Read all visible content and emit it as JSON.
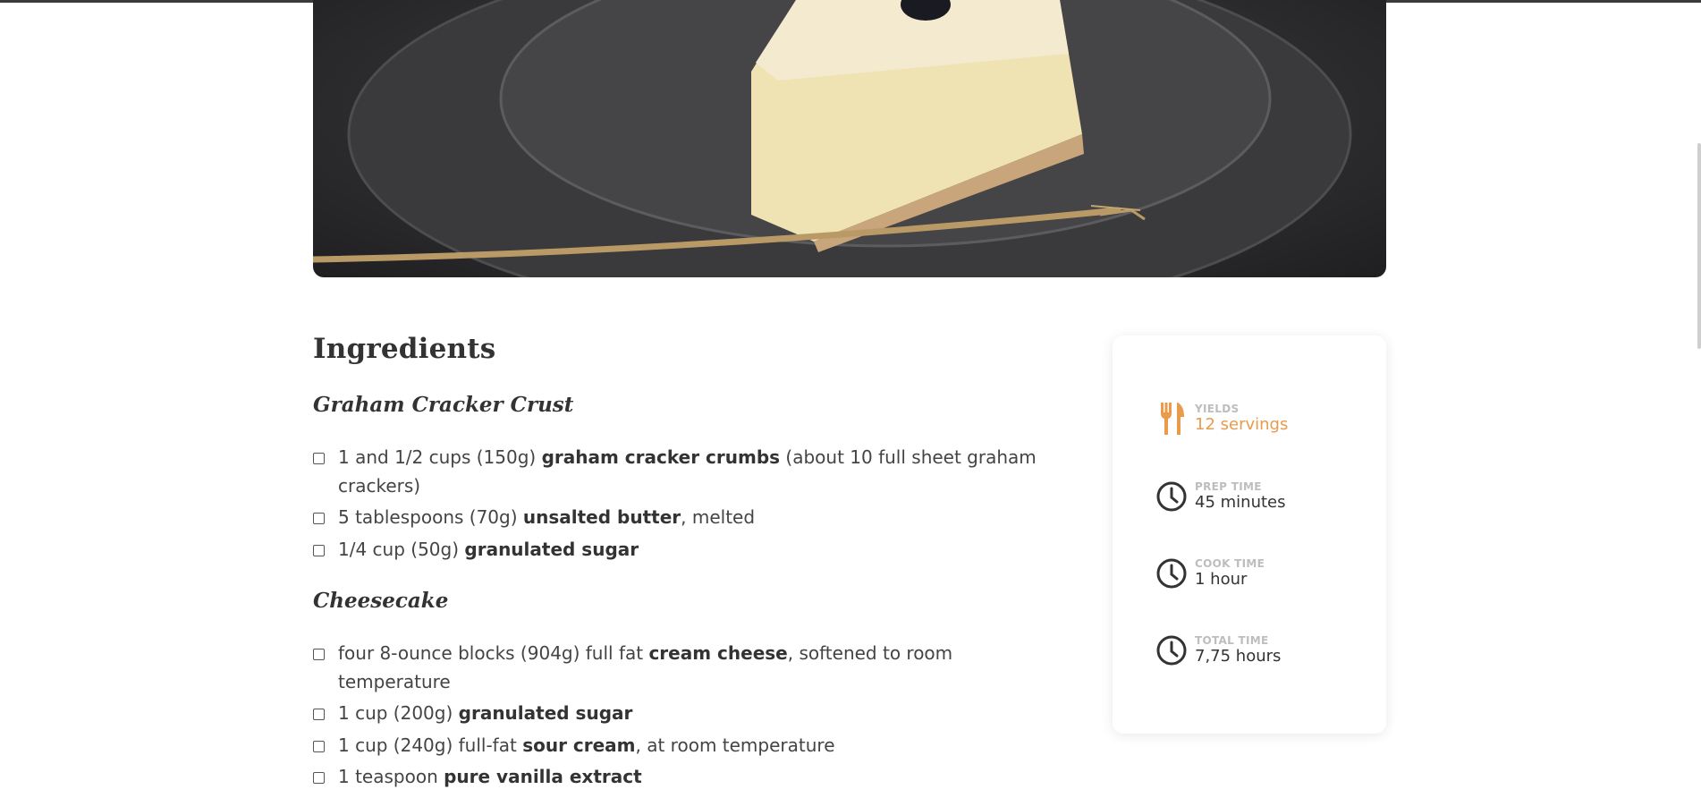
{
  "hero": {
    "image_description": "cheesecake-slice-photo"
  },
  "ingredients": {
    "title": "Ingredients",
    "groups": [
      {
        "title": "Graham Cracker Crust",
        "items": [
          {
            "prefix": "1 and 1/2 cups (150g) ",
            "bold": "graham cracker crumbs",
            "suffix": " (about 10 full sheet graham crackers)"
          },
          {
            "prefix": "5 tablespoons (70g) ",
            "bold": "unsalted butter",
            "suffix": ", melted"
          },
          {
            "prefix": "1/4 cup (50g) ",
            "bold": "granulated sugar",
            "suffix": ""
          }
        ]
      },
      {
        "title": "Cheesecake",
        "items": [
          {
            "prefix": "four 8-ounce blocks (904g) full fat ",
            "bold": "cream cheese",
            "suffix": ", softened to room temperature"
          },
          {
            "prefix": "1 cup (200g) ",
            "bold": "granulated sugar",
            "suffix": ""
          },
          {
            "prefix": "1 cup (240g) full-fat ",
            "bold": "sour cream",
            "suffix": ", at room temperature"
          },
          {
            "prefix": "1 teaspoon ",
            "bold": "pure vanilla extract",
            "suffix": ""
          }
        ]
      }
    ]
  },
  "info_card": {
    "yields": {
      "label": "YIELDS",
      "value": "12 servings",
      "icon": "fork-knife-icon"
    },
    "prep": {
      "label": "PREP TIME",
      "value": "45 minutes",
      "icon": "clock-icon"
    },
    "cook": {
      "label": "COOK TIME",
      "value": "1 hour",
      "icon": "clock-icon"
    },
    "total": {
      "label": "TOTAL TIME",
      "value": "7,75 hours",
      "icon": "clock-icon"
    }
  },
  "colors": {
    "accent": "#e99a4b",
    "text": "#333333",
    "muted_label": "#bdbdbd"
  }
}
